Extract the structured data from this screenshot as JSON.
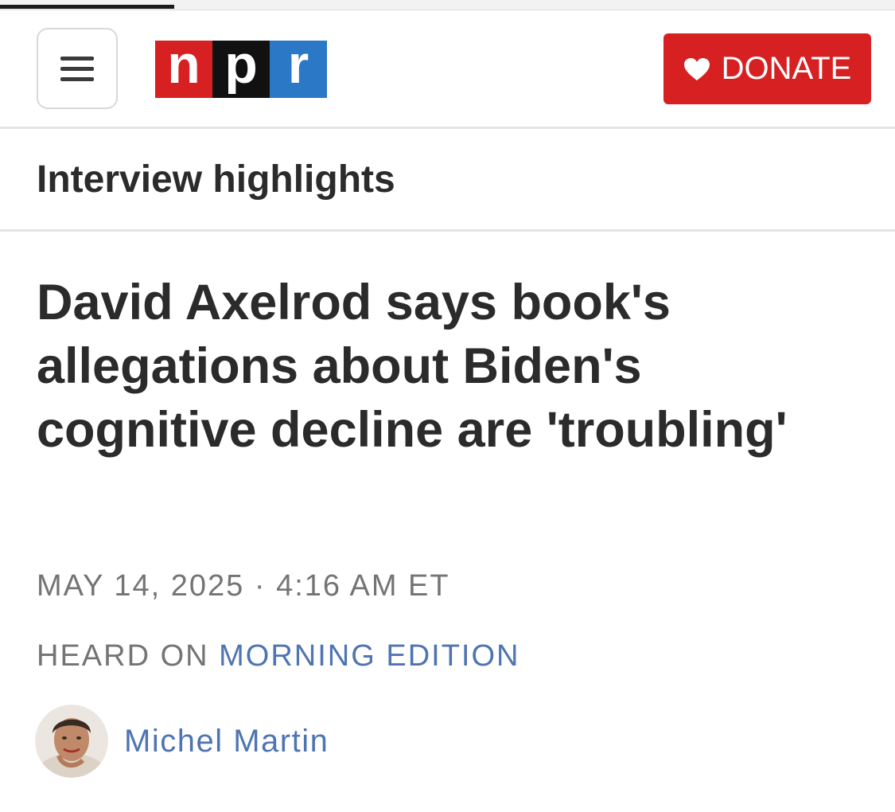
{
  "page_progress": {
    "read_fraction": 0.195
  },
  "header": {
    "menu_icon": "hamburger-menu-icon",
    "logo": {
      "letters": [
        "n",
        "p",
        "r"
      ],
      "colors": [
        "#d62021",
        "#111111",
        "#2a78c6"
      ]
    },
    "donate": {
      "icon": "heart-icon",
      "label": "DONATE",
      "color": "#d62021"
    }
  },
  "article": {
    "section": "Interview highlights",
    "headline": "David Axelrod says book's allegations about Biden's cognitive decline are 'troubling'",
    "date": "MAY 14, 2025 · 4:16 AM ET",
    "heard_on_prefix": "HEARD ON",
    "show_name": "MORNING EDITION",
    "link_color": "#4f74b3",
    "author": {
      "name": "Michel Martin",
      "avatar_icon": "author-avatar"
    }
  }
}
